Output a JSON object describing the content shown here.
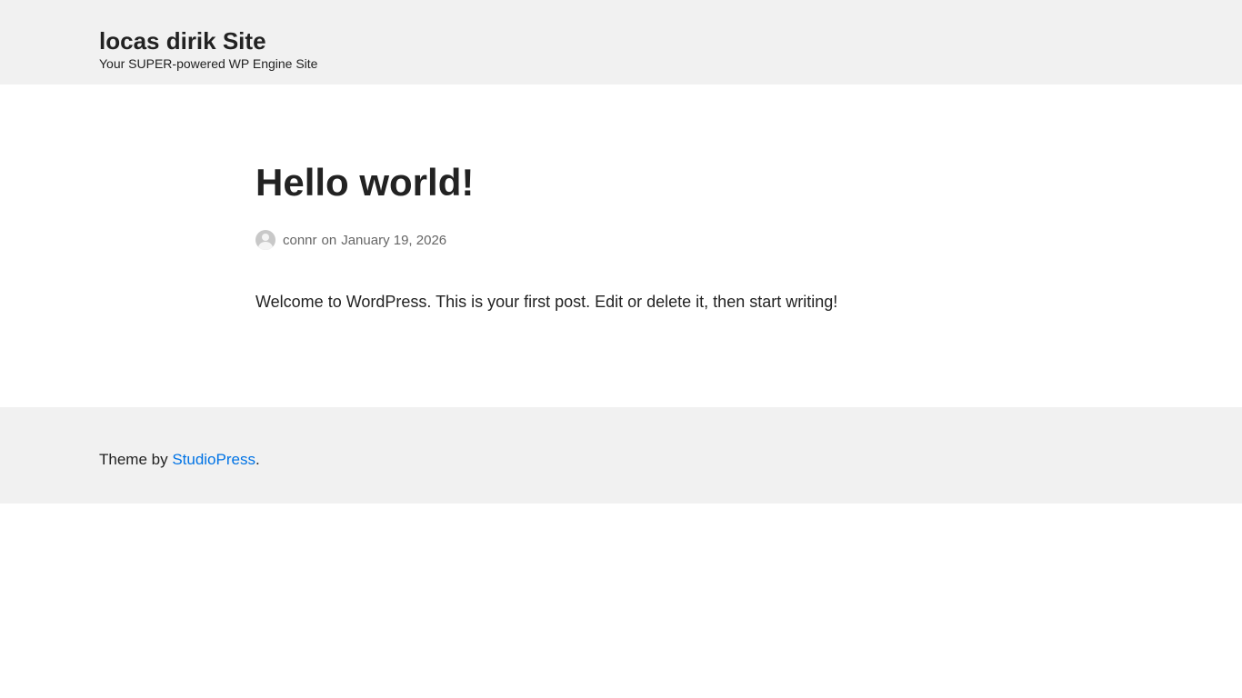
{
  "header": {
    "site_title": "locas dirik Site",
    "tagline": "Your SUPER-powered WP Engine Site"
  },
  "post": {
    "title": "Hello world!",
    "author": "connr",
    "date_prefix": "on",
    "date": "January 19, 2026",
    "content": "Welcome to WordPress. This is your first post. Edit or delete it, then start writing!"
  },
  "footer": {
    "prefix": "Theme by ",
    "link_label": "StudioPress",
    "suffix": "."
  },
  "colors": {
    "header_bg": "#f1f1f1",
    "text": "#222222",
    "meta_text": "#666666",
    "link": "#0073e5"
  },
  "icons": {
    "avatar": "default-user-avatar-icon"
  }
}
